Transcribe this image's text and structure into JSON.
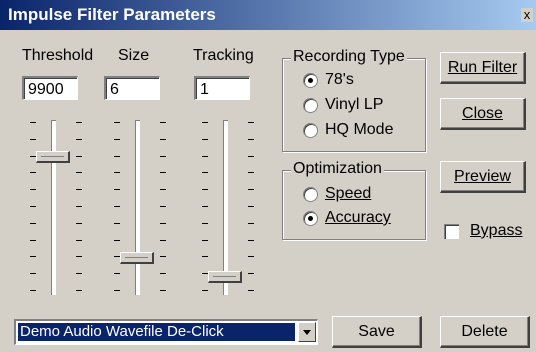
{
  "window": {
    "title": "Impulse Filter Parameters",
    "close_glyph": "x"
  },
  "sliders": [
    {
      "label": "Threshold",
      "value": "9900",
      "position": 0.2
    },
    {
      "label": "Size",
      "value": "6",
      "position": 0.82
    },
    {
      "label": "Tracking",
      "value": "1",
      "position": 0.93
    }
  ],
  "recording_type": {
    "legend": "Recording Type",
    "options": [
      {
        "label": "78's",
        "selected": true
      },
      {
        "label": "Vinyl LP",
        "selected": false
      },
      {
        "label": "HQ Mode",
        "selected": false
      }
    ]
  },
  "optimization": {
    "legend": "Optimization",
    "options": [
      {
        "label": "Speed",
        "selected": false
      },
      {
        "label": "Accuracy",
        "selected": true
      }
    ]
  },
  "buttons": {
    "run_filter": "Run Filter",
    "close": "Close",
    "preview": "Preview",
    "save": "Save",
    "delete": "Delete"
  },
  "bypass": {
    "label": "Bypass",
    "checked": false
  },
  "preset": {
    "selected": "Demo Audio Wavefile De-Click"
  },
  "colors": {
    "titlebar_start": "#0a246a",
    "titlebar_end": "#a6caf0",
    "face": "#d4d0c8",
    "selection": "#0a246a"
  }
}
